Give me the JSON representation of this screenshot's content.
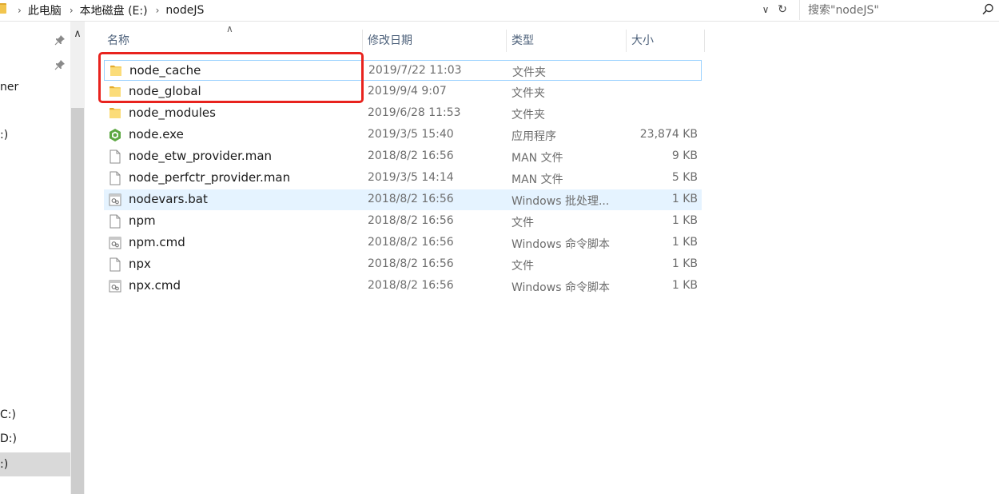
{
  "address_bar": {
    "breadcrumbs": [
      "此电脑",
      "本地磁盘 (E:)",
      "nodeJS"
    ]
  },
  "search": {
    "placeholder": "搜索\"nodeJS\""
  },
  "nav": {
    "items": [
      {
        "label": "ner"
      },
      {
        "label": ":)"
      },
      {
        "label": "C:)"
      },
      {
        "label": "D:)"
      },
      {
        "label": ":)"
      }
    ]
  },
  "columns": {
    "name": "名称",
    "date": "修改日期",
    "type": "类型",
    "size": "大小"
  },
  "files": [
    {
      "name": "node_cache",
      "date": "2019/7/22 11:03",
      "type": "文件夹",
      "size": "",
      "icon": "folder-icon"
    },
    {
      "name": "node_global",
      "date": "2019/9/4 9:07",
      "type": "文件夹",
      "size": "",
      "icon": "folder-icon"
    },
    {
      "name": "node_modules",
      "date": "2019/6/28 11:53",
      "type": "文件夹",
      "size": "",
      "icon": "folder-icon"
    },
    {
      "name": "node.exe",
      "date": "2019/3/5 15:40",
      "type": "应用程序",
      "size": "23,874 KB",
      "icon": "nodejs-app-icon"
    },
    {
      "name": "node_etw_provider.man",
      "date": "2018/8/2 16:56",
      "type": "MAN 文件",
      "size": "9 KB",
      "icon": "file-icon"
    },
    {
      "name": "node_perfctr_provider.man",
      "date": "2019/3/5 14:14",
      "type": "MAN 文件",
      "size": "5 KB",
      "icon": "file-icon"
    },
    {
      "name": "nodevars.bat",
      "date": "2018/8/2 16:56",
      "type": "Windows 批处理...",
      "size": "1 KB",
      "icon": "batch-file-icon"
    },
    {
      "name": "npm",
      "date": "2018/8/2 16:56",
      "type": "文件",
      "size": "1 KB",
      "icon": "file-icon"
    },
    {
      "name": "npm.cmd",
      "date": "2018/8/2 16:56",
      "type": "Windows 命令脚本",
      "size": "1 KB",
      "icon": "batch-file-icon"
    },
    {
      "name": "npx",
      "date": "2018/8/2 16:56",
      "type": "文件",
      "size": "1 KB",
      "icon": "file-icon"
    },
    {
      "name": "npx.cmd",
      "date": "2018/8/2 16:56",
      "type": "Windows 命令脚本",
      "size": "1 KB",
      "icon": "batch-file-icon"
    }
  ],
  "colors": {
    "highlight_box": "#e8231e",
    "row_hover": "#e5f3ff",
    "row_focus_border": "#99d1ff",
    "nav_selected": "#d9d9d9"
  }
}
